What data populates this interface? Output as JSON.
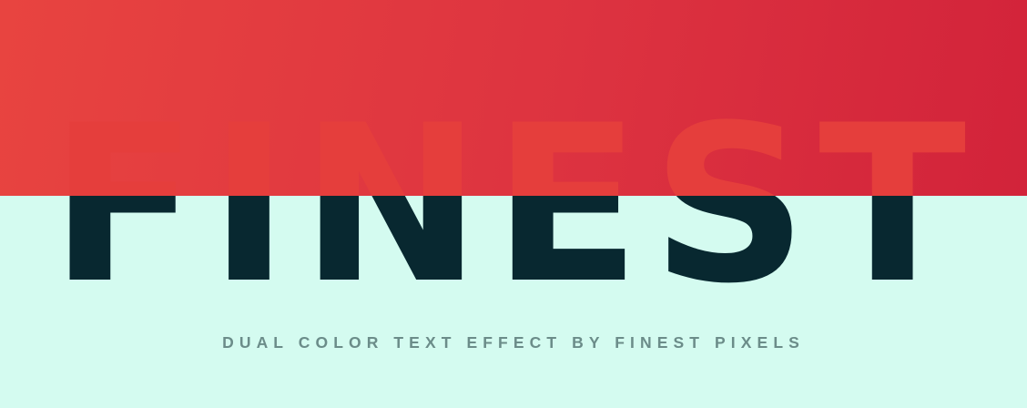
{
  "hero": {
    "headline": "FINEST",
    "subtitle": "DUAL COLOR TEXT EFFECT BY FINEST PIXELS"
  },
  "colors": {
    "top_background": "#e03a3f",
    "bottom_background": "#d4fbf0",
    "text_top": "#e53e3c",
    "text_bottom": "#082830",
    "subtitle": "#6b8c89"
  }
}
